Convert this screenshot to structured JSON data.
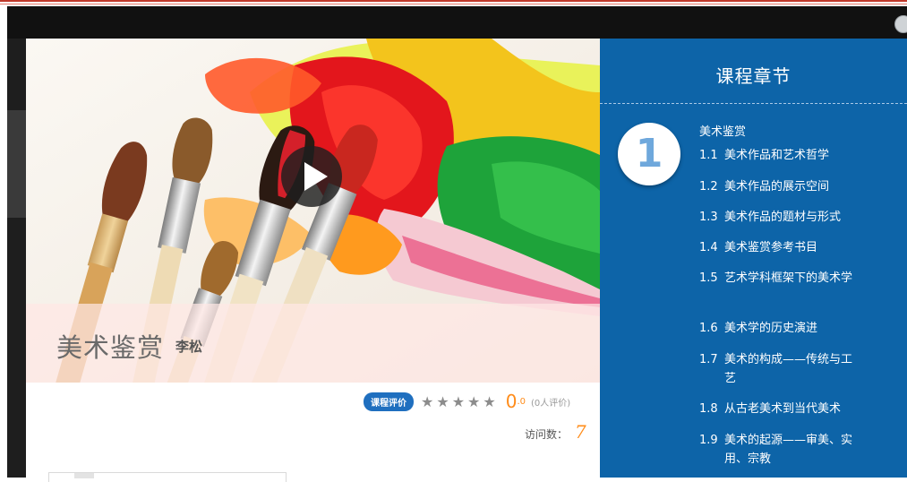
{
  "course": {
    "title": "美术鉴赏",
    "teacher": "李松"
  },
  "rating": {
    "badge": "课程评价",
    "stars": [
      "★",
      "★",
      "★",
      "★",
      "★"
    ],
    "score_int": "0",
    "score_dec": ".0",
    "reviews": "(0人评价)"
  },
  "visits": {
    "label": "访问数：",
    "value": "7"
  },
  "panel": {
    "title": "课程章节",
    "chapter_number": "1",
    "chapter_name": "美术鉴赏",
    "sections": [
      {
        "no": "1.1",
        "text": "美术作品和艺术哲学"
      },
      {
        "no": "1.2",
        "text": "美术作品的展示空间"
      },
      {
        "no": "1.3",
        "text": "美术作品的题材与形式"
      },
      {
        "no": "1.4",
        "text": "美术鉴赏参考书目"
      },
      {
        "no": "1.5",
        "text": "艺术学科框架下的美术学"
      },
      {
        "no": "1.6",
        "text": "美术学的历史演进"
      },
      {
        "no": "1.7",
        "text": "美术的构成——传统与工艺"
      },
      {
        "no": "1.8",
        "text": "从古老美术到当代美术"
      },
      {
        "no": "1.9",
        "text": "美术的起源——审美、实用、宗教"
      }
    ]
  },
  "colors": {
    "panel_blue": "#0d64a8",
    "badge_blue": "#1f6fbf",
    "accent_orange": "#ff8c1a",
    "top_bar": "#111111"
  }
}
